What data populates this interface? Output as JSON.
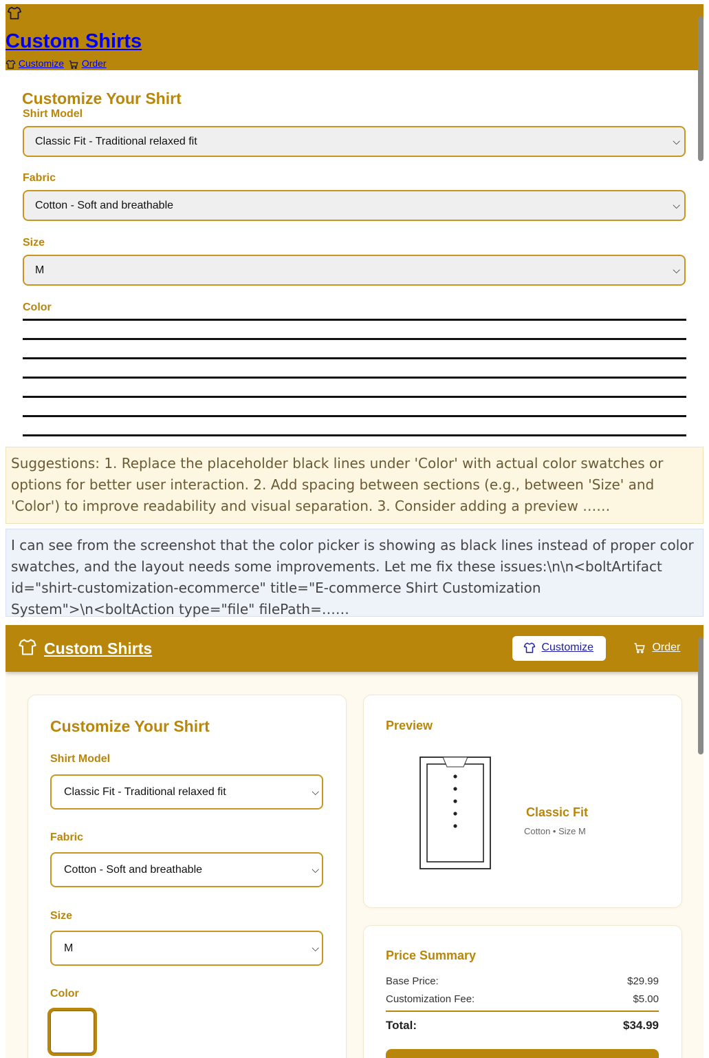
{
  "top_screenshot": {
    "brand": "Custom Shirts",
    "nav": {
      "customize": "Customize",
      "order": "Order"
    },
    "title": "Customize Your Shirt",
    "fields": {
      "model_label": "Shirt Model",
      "model_value": "Classic Fit - Traditional relaxed fit",
      "fabric_label": "Fabric",
      "fabric_value": "Cotton - Soft and breathable",
      "size_label": "Size",
      "size_value": "M",
      "color_label": "Color"
    }
  },
  "messages": {
    "suggestion": "Suggestions: 1. Replace the placeholder black lines under 'Color' with actual color swatches or options for better user interaction. 2. Add spacing between sections (e.g., between 'Size' and 'Color') to improve readability and visual separation. 3. Consider adding a preview ……",
    "reply": "I can see from the screenshot that the color picker is showing as black lines instead of proper color swatches, and the layout needs some improvements. Let me fix these issues:\\n\\n<boltArtifact id=\"shirt-customization-ecommerce\" title=\"E-commerce Shirt Customization System\">\\n<boltAction type=\"file\" filePath=……"
  },
  "bottom_screenshot": {
    "brand": "Custom Shirts",
    "nav": {
      "customize": "Customize",
      "order": "Order"
    },
    "title": "Customize Your Shirt",
    "fields": {
      "model_label": "Shirt Model",
      "model_value": "Classic Fit - Traditional relaxed fit",
      "fabric_label": "Fabric",
      "fabric_value": "Cotton - Soft and breathable",
      "size_label": "Size",
      "size_value": "M",
      "color_label": "Color"
    },
    "preview": {
      "heading": "Preview",
      "model_name": "Classic Fit",
      "model_sub": "Cotton • Size M"
    },
    "price": {
      "heading": "Price Summary",
      "base_label": "Base Price:",
      "base_value": "$29.99",
      "fee_label": "Customization Fee:",
      "fee_value": "$5.00",
      "total_label": "Total:",
      "total_value": "$34.99"
    }
  },
  "colors": {
    "brand_gold": "#b8860b",
    "link_blue": "#0000ee",
    "cream_bg": "#fffaf0"
  }
}
